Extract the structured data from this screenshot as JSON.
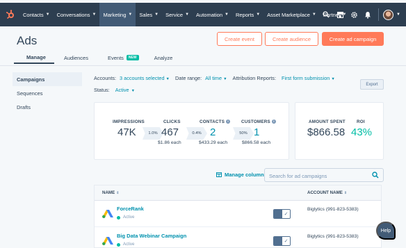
{
  "nav": {
    "items": [
      {
        "label": "Contacts",
        "active": false
      },
      {
        "label": "Conversations",
        "active": false
      },
      {
        "label": "Marketing",
        "active": true
      },
      {
        "label": "Sales",
        "active": false
      },
      {
        "label": "Service",
        "active": false
      },
      {
        "label": "Automation",
        "active": false
      },
      {
        "label": "Reports",
        "active": false
      },
      {
        "label": "Asset Marketplace",
        "active": false
      },
      {
        "label": "Partner",
        "active": false
      }
    ],
    "icons": [
      "search-icon",
      "marketplace-icon",
      "settings-icon",
      "notifications-icon"
    ]
  },
  "header": {
    "title": "Ads",
    "create_event": "Create event",
    "create_audience": "Create audience",
    "create_campaign": "Create ad campaign"
  },
  "tabs": {
    "manage": "Manage",
    "audiences": "Audiences",
    "events": "Events",
    "events_badge": "NEW",
    "analyze": "Analyze"
  },
  "sidebar": {
    "items": [
      {
        "label": "Campaigns",
        "active": true
      },
      {
        "label": "Sequences",
        "active": false
      },
      {
        "label": "Drafts",
        "active": false
      }
    ]
  },
  "filters": {
    "accounts_label": "Accounts:",
    "accounts_value": "3 accounts selected",
    "date_label": "Date range:",
    "date_value": "All time",
    "attribution_label": "Attribution Reports:",
    "attribution_value": "First form submission",
    "status_label": "Status:",
    "status_value": "Active",
    "export": "Export"
  },
  "stats": {
    "impressions_label": "IMPRESSIONS",
    "impressions_value": "47K",
    "ctr": "1.0%",
    "clicks_label": "CLICKS",
    "clicks_value": "467",
    "clicks_each": "$1.86 each",
    "contact_rate": "0.4%",
    "contacts_label": "CONTACTS",
    "contacts_value": "2",
    "contacts_each": "$433.29 each",
    "customer_rate": "50%",
    "customers_label": "CUSTOMERS",
    "customers_value": "1",
    "customers_each": "$866.58 each",
    "spent_label": "AMOUNT SPENT",
    "spent_value": "$866.58",
    "roi_label": "ROI",
    "roi_value": "43%"
  },
  "table": {
    "manage_columns": "Manage columns",
    "search_placeholder": "Search for ad campaigns",
    "col_name": "NAME",
    "col_account": "ACCOUNT NAME",
    "rows": [
      {
        "name": "ForceRank",
        "status": "Active",
        "account": "Biglytics (991-823-5383)"
      },
      {
        "name": "Big Data Webinar Campaign",
        "status": "Active",
        "account": "Biglytics (991-823-5383)"
      }
    ]
  },
  "help": "Help",
  "colors": {
    "nav_bg": "#2d3e50",
    "accent": "#ff7a59",
    "link": "#0091ae",
    "positive": "#00bda5"
  }
}
